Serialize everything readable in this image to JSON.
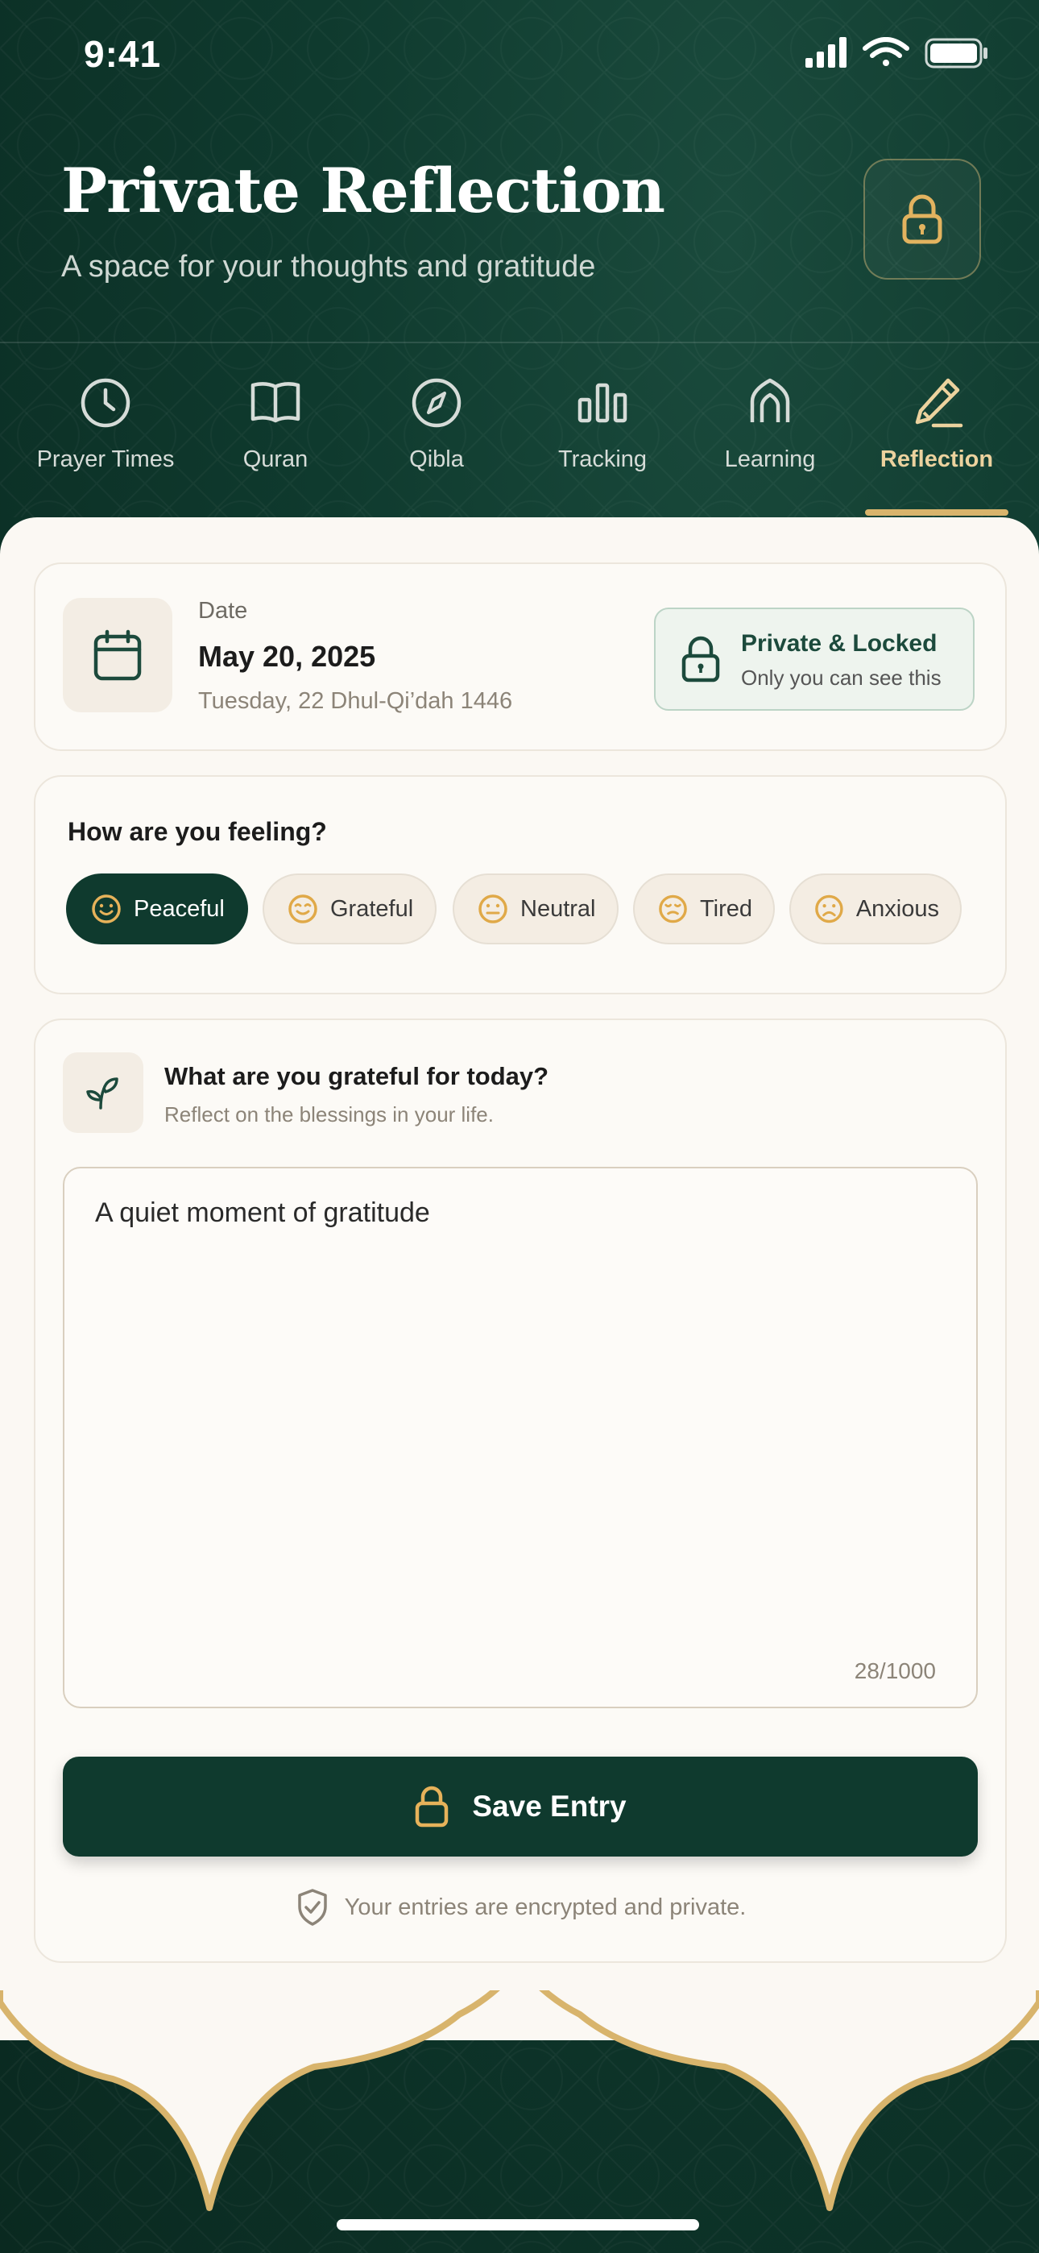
{
  "status_bar": {
    "time": "9:41"
  },
  "header": {
    "title": "Private Reflection",
    "subtitle": "A space for your thoughts and gratitude",
    "lock_icon": "lock-icon"
  },
  "nav": {
    "items": [
      {
        "label": "Prayer Times",
        "icon": "clock-icon"
      },
      {
        "label": "Quran",
        "icon": "book-icon"
      },
      {
        "label": "Qibla",
        "icon": "compass-icon"
      },
      {
        "label": "Tracking",
        "icon": "bar-chart-icon"
      },
      {
        "label": "Learning",
        "icon": "mosque-arch-icon"
      },
      {
        "label": "Reflection",
        "icon": "pen-icon"
      }
    ],
    "active": "Reflection"
  },
  "date_card": {
    "label": "Date",
    "date": "May 20, 2025",
    "hijri": "Tuesday, 22 Dhul-Qi’dah 1446",
    "privacy_badge": {
      "title": "Private & Locked",
      "subtitle": "Only you can see this"
    }
  },
  "mood": {
    "title": "How are you feeling?",
    "options": [
      "Peaceful",
      "Grateful",
      "Neutral",
      "Tired",
      "Anxious"
    ],
    "selected": "Peaceful"
  },
  "gratitude": {
    "title": "What are you grateful for today?",
    "subtitle": "Reflect on the blessings in your life.",
    "entry_text": "A quiet moment of gratitude",
    "char_count": "28/1000"
  },
  "actions": {
    "save_label": "Save Entry",
    "encryption_note": "Your entries are encrypted and private."
  },
  "colors": {
    "primary_green": "#0f3a2e",
    "accent_gold": "#d8b46c",
    "background_cream": "#fbf8f3"
  }
}
